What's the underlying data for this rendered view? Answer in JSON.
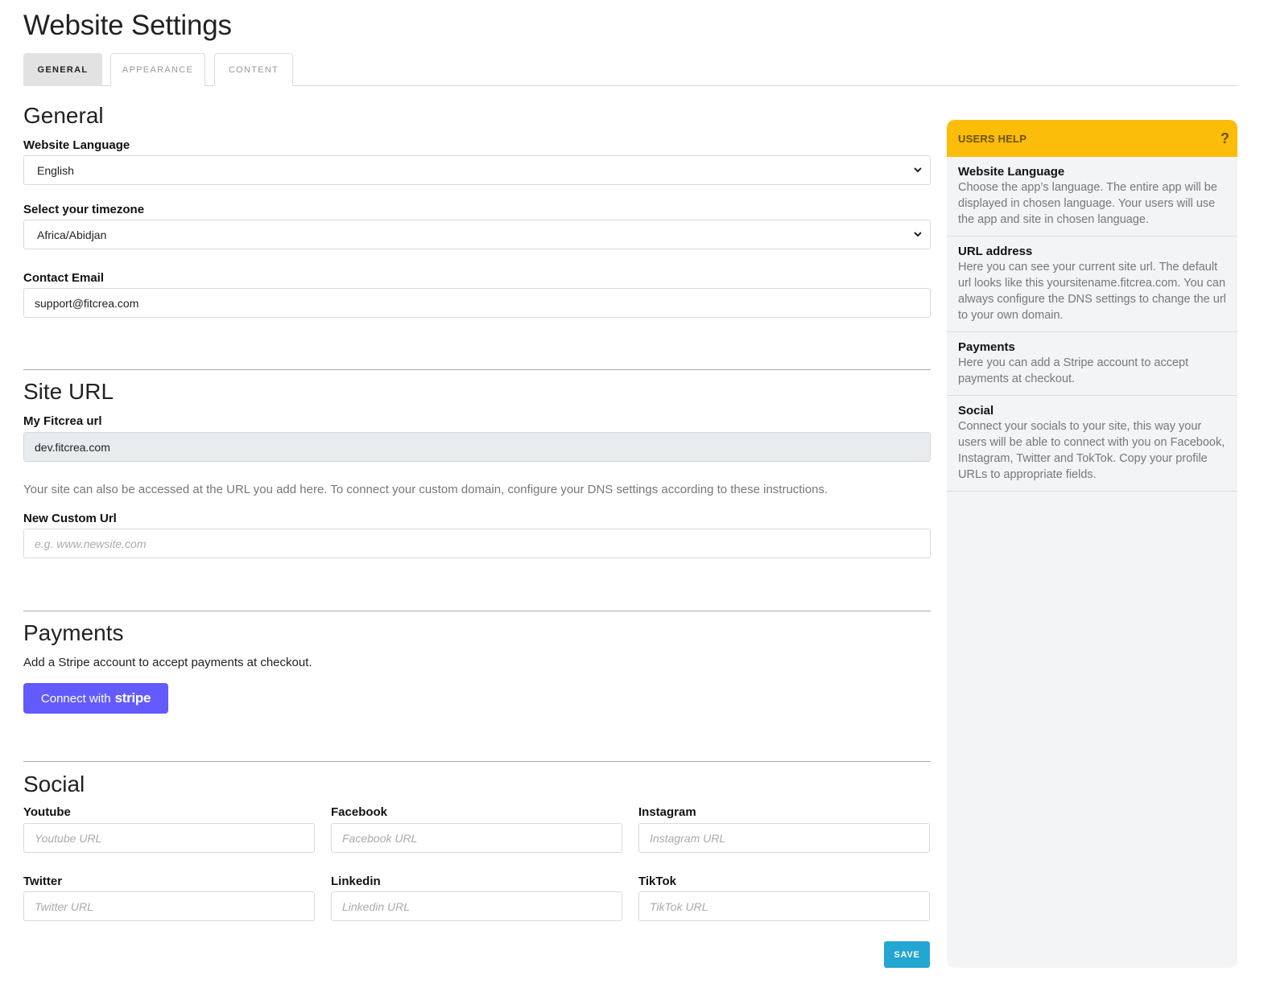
{
  "page": {
    "title": "Website Settings"
  },
  "tabs": [
    {
      "label": "GENERAL",
      "active": true
    },
    {
      "label": "APPEARANCE",
      "active": false
    },
    {
      "label": "CONTENT",
      "active": false
    }
  ],
  "general": {
    "title": "General",
    "language": {
      "label": "Website Language",
      "value": "English"
    },
    "timezone": {
      "label": "Select your timezone",
      "value": "Africa/Abidjan"
    },
    "email": {
      "label": "Contact Email",
      "value": "support@fitcrea.com"
    }
  },
  "site_url": {
    "title": "Site URL",
    "fitcrea_url": {
      "label": "My Fitcrea url",
      "value": "dev.fitcrea.com"
    },
    "info": "Your site can also be accessed at the URL you add here. To connect your custom domain, configure your DNS settings according to these instructions.",
    "custom_url": {
      "label": "New Custom Url",
      "value": "",
      "placeholder": "e.g. www.newsite.com"
    }
  },
  "payments": {
    "title": "Payments",
    "description": "Add a Stripe account to accept payments at checkout.",
    "connect_button": {
      "prefix": "Connect with",
      "brand": "stripe",
      "color": "#635bff"
    }
  },
  "social": {
    "title": "Social",
    "fields": [
      {
        "label": "Youtube",
        "placeholder": "Youtube URL",
        "value": ""
      },
      {
        "label": "Facebook",
        "placeholder": "Facebook URL",
        "value": ""
      },
      {
        "label": "Instagram",
        "placeholder": "Instagram URL",
        "value": ""
      },
      {
        "label": "Twitter",
        "placeholder": "Twitter URL",
        "value": ""
      },
      {
        "label": "Linkedin",
        "placeholder": "Linkedin URL",
        "value": ""
      },
      {
        "label": "TikTok",
        "placeholder": "TikTok URL",
        "value": ""
      }
    ]
  },
  "save_button": {
    "label": "SAVE",
    "color": "#23a6d1"
  },
  "help": {
    "title": "USERS HELP",
    "icon": "question-icon",
    "accent": "#fbbc0a",
    "items": [
      {
        "heading": "Website Language",
        "text": "Choose the app’s language. The entire app will be displayed in chosen language. Your users will use the app and site in chosen language."
      },
      {
        "heading": "URL address",
        "text": "Here you can see your current site url. The default url looks like this yoursitename.fitcrea.com. You can always configure the DNS settings to change the url to your own domain."
      },
      {
        "heading": "Payments",
        "text": "Here you can add a Stripe account to accept payments at checkout."
      },
      {
        "heading": "Social",
        "text": "Connect your socials to your site, this way your users will be able to connect with you on Facebook, Instagram, Twitter and TokTok. Copy your profile URLs to appropriate fields."
      }
    ]
  }
}
